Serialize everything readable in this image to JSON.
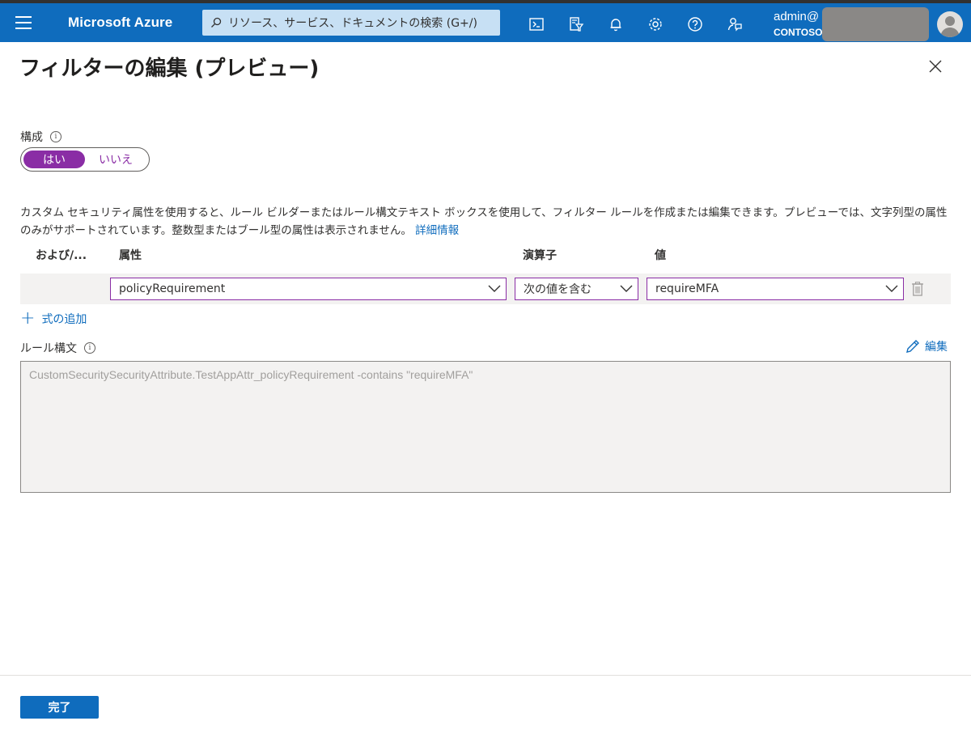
{
  "header": {
    "brand": "Microsoft Azure",
    "search_placeholder": "リソース、サービス、ドキュメントの検索 (G+/)",
    "account_name": "admin@",
    "account_tenant": "CONTOSO",
    "icons": [
      "cloud-shell-icon",
      "directory-filter-icon",
      "notifications-icon",
      "settings-icon",
      "help-icon",
      "feedback-icon"
    ]
  },
  "panel": {
    "title": "フィルターの編集 (プレビュー)",
    "configure_label": "構成",
    "toggle": {
      "yes": "はい",
      "no": "いいえ",
      "selected": "はい"
    },
    "description": "カスタム セキュリティ属性を使用すると、ルール ビルダーまたはルール構文テキスト ボックスを使用して、フィルター ルールを作成または編集できます。プレビューでは、文字列型の属性のみがサポートされています。整数型またはブール型の属性は表示されません。",
    "learn_more": "詳細情報",
    "columns": {
      "andor": "および/...",
      "attribute": "属性",
      "operator": "演算子",
      "value": "値"
    },
    "rule": {
      "attribute": "policyRequirement",
      "operator": "次の値を含む",
      "value": "requireMFA"
    },
    "add_expression": "式の追加",
    "syntax_label": "ルール構文",
    "edit_label": "編集",
    "syntax_text": "CustomSecuritySecurityAttribute.TestAppAttr_policyRequirement -contains \"requireMFA\"",
    "done_label": "完了"
  },
  "colors": {
    "header_bg": "#0f6cbd",
    "accent_purple": "#8a2da5",
    "link_blue": "#0f6cbd"
  }
}
